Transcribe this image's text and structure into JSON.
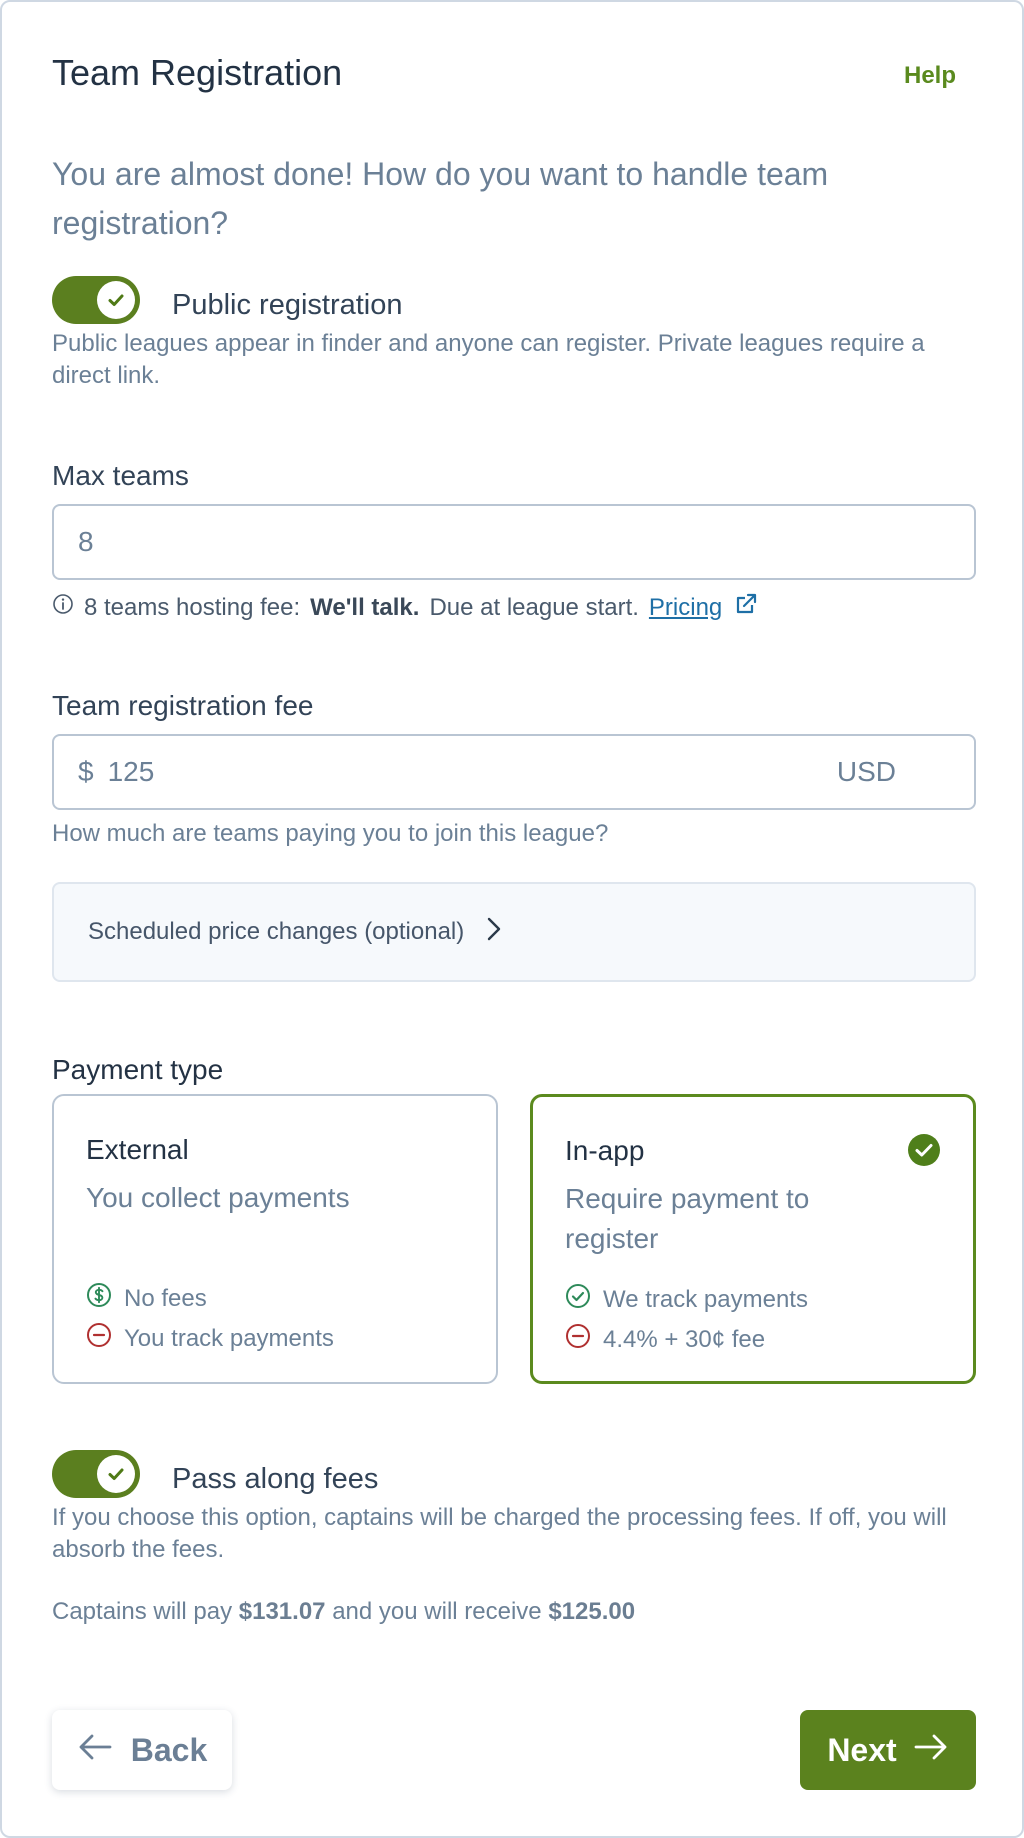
{
  "header": {
    "title": "Team Registration",
    "help_label": "Help"
  },
  "lead": "You are almost done! How do you want to handle team registration?",
  "public_registration": {
    "label": "Public registration",
    "enabled": true,
    "description": "Public leagues appear in finder and anyone can register. Private leagues require a direct link."
  },
  "max_teams": {
    "label": "Max teams",
    "value": "8",
    "hint_prefix": "8 teams hosting fee:",
    "hint_bold": "We'll talk.",
    "hint_suffix": "Due at league start.",
    "hint_link": "Pricing"
  },
  "registration_fee": {
    "label": "Team registration fee",
    "prefix": "$",
    "value": "125",
    "currency": "USD",
    "help": "How much are teams paying you to join this league?"
  },
  "scheduled_changes": {
    "label": "Scheduled price changes (optional)"
  },
  "payment_type": {
    "label": "Payment type",
    "options": [
      {
        "title": "External",
        "subtitle": "You collect payments",
        "lines": [
          "No fees",
          "You track payments"
        ],
        "selected": false
      },
      {
        "title": "In-app",
        "subtitle": "Require payment to register",
        "lines": [
          "We track payments",
          "4.4% + 30¢ fee"
        ],
        "selected": true
      }
    ]
  },
  "pass_fees": {
    "label": "Pass along fees",
    "enabled": true,
    "description": "If you choose this option, captains will be charged the processing fees. If off, you will absorb the fees."
  },
  "summary": {
    "prefix": "Captains will pay",
    "captain_amount": "$131.07",
    "middle": "and you will receive",
    "receive_amount": "$125.00"
  },
  "footer": {
    "back_label": "Back",
    "next_label": "Next"
  },
  "colors": {
    "accent": "#5b821e",
    "link": "#1e6fa6",
    "positive": "#2e8a5a",
    "negative": "#b03030"
  },
  "icons": [
    "check-icon",
    "info-icon",
    "external-link-icon",
    "chevron-right-icon",
    "dollar-circle-icon",
    "check-circle-icon",
    "minus-circle-icon",
    "arrow-left-icon",
    "arrow-right-icon"
  ]
}
